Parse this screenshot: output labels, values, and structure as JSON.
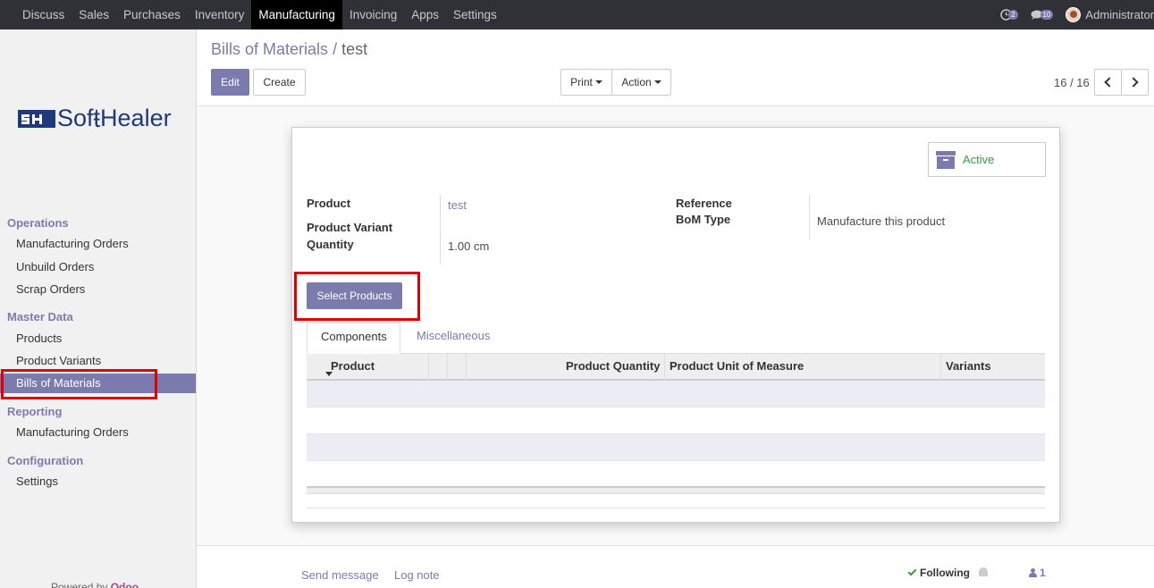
{
  "topbar": {
    "apps": [
      "Discuss",
      "Sales",
      "Purchases",
      "Inventory",
      "Manufacturing",
      "Invoicing",
      "Apps",
      "Settings"
    ],
    "active_app": "Manufacturing",
    "activity_count": "2",
    "message_count": "10",
    "user": "Administrator"
  },
  "sidebar": {
    "logo_text": "Sof\tHealer",
    "logo_mark": "SH",
    "sections": {
      "operations": "Operations",
      "master_data": "Master Data",
      "reporting": "Reporting",
      "configuration": "Configuration"
    },
    "items": {
      "mo": "Manufacturing Orders",
      "unbuild": "Unbuild Orders",
      "scrap": "Scrap Orders",
      "products": "Products",
      "variants": "Product Variants",
      "bom": "Bills of Materials",
      "reporting_mo": "Manufacturing Orders",
      "settings": "Settings"
    },
    "powered_prefix": "Powered by",
    "powered_brand": "Odoo"
  },
  "control": {
    "breadcrumb_parent": "Bills of Materials",
    "breadcrumb_sep": "/",
    "breadcrumb_current": "test",
    "edit": "Edit",
    "create": "Create",
    "print": "Print",
    "action": "Action",
    "pager": "16 / 16"
  },
  "form": {
    "status": "Active",
    "labels": {
      "product": "Product",
      "variant": "Product Variant",
      "quantity": "Quantity",
      "reference": "Reference",
      "bom_type": "BoM Type"
    },
    "values": {
      "product": "test",
      "quantity": "1.00",
      "uom": "cm",
      "bom_type": "Manufacture this product"
    },
    "select_products": "Select Products",
    "tabs": [
      "Components",
      "Miscellaneous"
    ],
    "columns": [
      "Product",
      "Product Quantity",
      "Product Unit of Measure",
      "Variants"
    ]
  },
  "chatter": {
    "send_message": "Send message",
    "log_note": "Log note",
    "following": "Following",
    "followers": "1"
  },
  "colors": {
    "brand": "#7c7bad",
    "highlight": "#e00000",
    "topbar": "#2f3136"
  }
}
